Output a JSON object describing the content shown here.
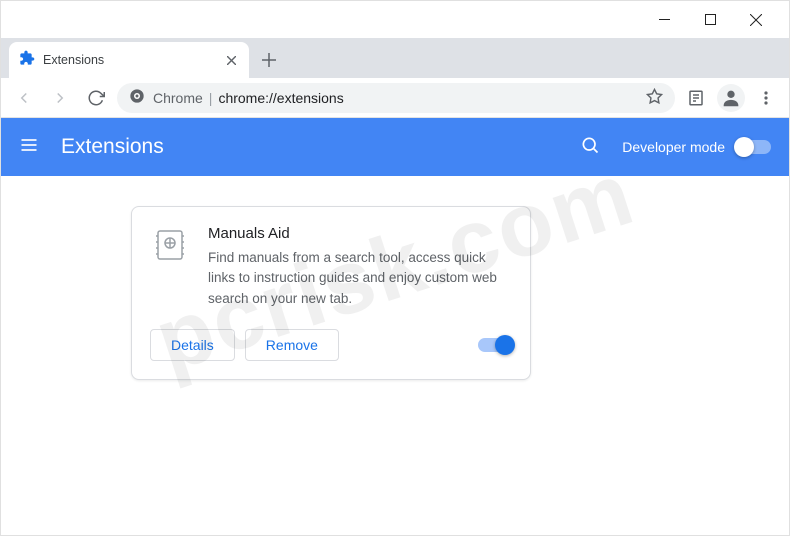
{
  "window": {
    "tab_title": "Extensions"
  },
  "omnibox": {
    "host": "Chrome",
    "path": "chrome://extensions"
  },
  "header": {
    "title": "Extensions",
    "developer_mode_label": "Developer mode",
    "developer_mode_on": false
  },
  "extension": {
    "name": "Manuals Aid",
    "description": "Find manuals from a search tool, access quick links to instruction guides and enjoy custom web search on your new tab.",
    "details_label": "Details",
    "remove_label": "Remove",
    "enabled": true
  },
  "watermark": "pcrisk.com"
}
